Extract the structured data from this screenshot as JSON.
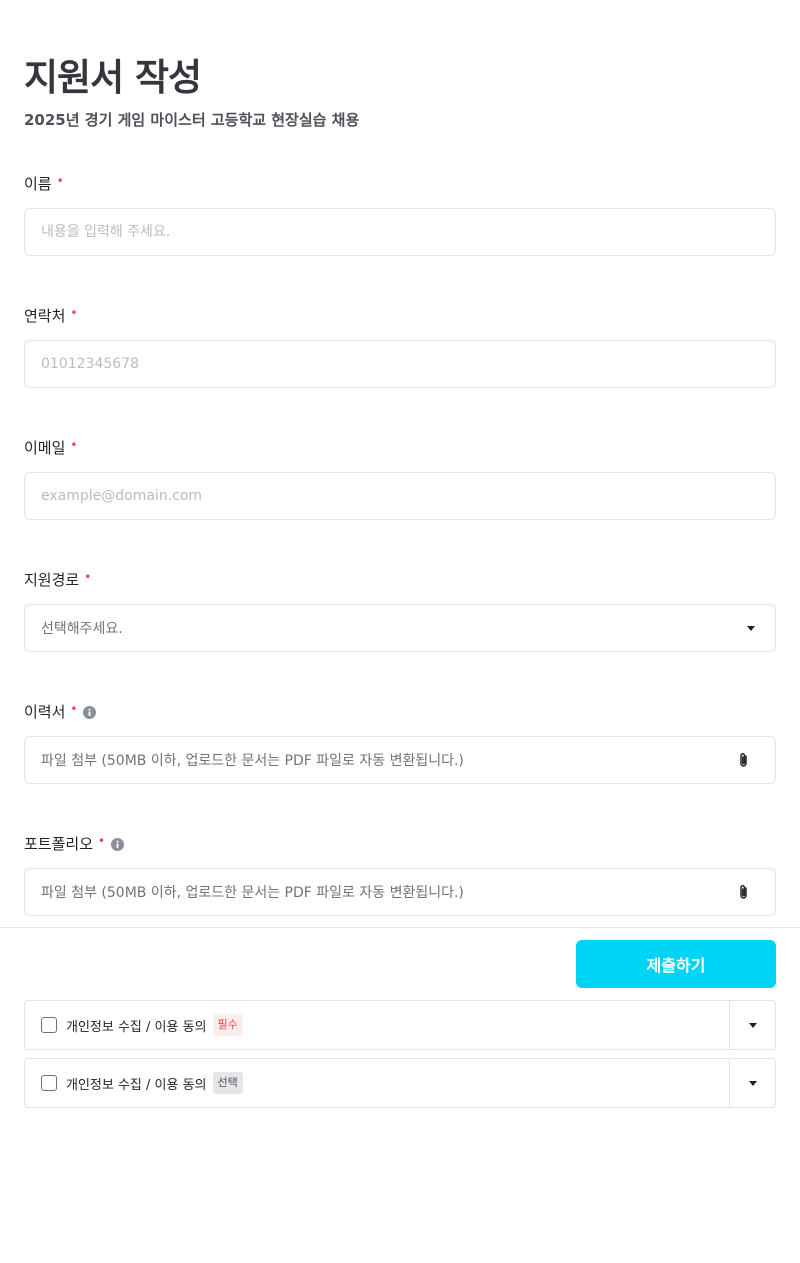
{
  "header": {
    "title": "지원서 작성",
    "subtitle": "2025년 경기 게임 마이스터 고등학교 현장실습 채용"
  },
  "form": {
    "required_mark": "•",
    "name": {
      "label": "이름",
      "placeholder": "내용을 입력해 주세요.",
      "value": ""
    },
    "phone": {
      "label": "연락처",
      "placeholder": "01012345678",
      "value": ""
    },
    "email": {
      "label": "이메일",
      "placeholder": "example@domain.com",
      "value": ""
    },
    "source": {
      "label": "지원경로",
      "selected": "선택해주세요."
    },
    "resume": {
      "label": "이력서",
      "file_hint": "파일 첨부 (50MB 이하, 업로드한 문서는 PDF 파일로 자동 변환됩니다.)"
    },
    "portfolio": {
      "label": "포트폴리오",
      "file_hint": "파일 첨부 (50MB 이하, 업로드한 문서는 PDF 파일로 자동 변환됩니다.)"
    }
  },
  "footer": {
    "submit_label": "제출하기",
    "consents": [
      {
        "label": "개인정보 수집 / 이용 동의",
        "tag": "필수",
        "checked": false
      },
      {
        "label": "개인정보 수집 / 이용 동의",
        "tag": "선택",
        "checked": false
      }
    ]
  },
  "icons": {
    "info": "info-icon",
    "dropdown": "caret-down-icon",
    "attach": "paperclip-icon"
  },
  "colors": {
    "accent": "#00d4f5",
    "required": "#f04452",
    "border": "#e1e3e8"
  }
}
